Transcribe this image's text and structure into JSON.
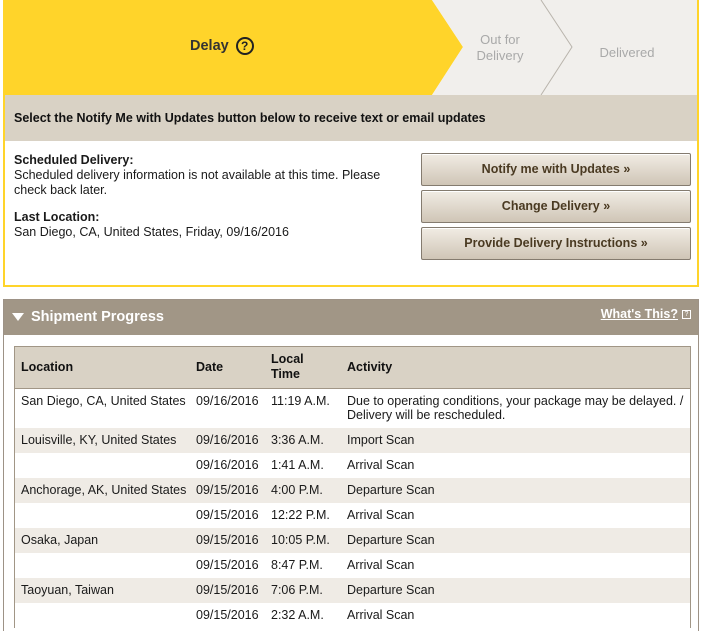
{
  "steps": {
    "current": "Delay",
    "help": "?",
    "out_for_delivery": "Out for\nDelivery",
    "delivered": "Delivered"
  },
  "colors": {
    "active": "#ffd42a",
    "inactive": "#f1efec",
    "band": "#d9d2c5",
    "header": "#a19686"
  },
  "notify_text": "Select the Notify Me with Updates button below to receive text or email updates",
  "scheduled": {
    "label": "Scheduled Delivery:",
    "text": "Scheduled delivery information is not available at this time. Please check back later."
  },
  "last_location": {
    "label": "Last Location:",
    "text": "San Diego, CA, United States, Friday, 09/16/2016"
  },
  "buttons": {
    "notify": "Notify me with Updates »",
    "change": "Change Delivery »",
    "instructions": "Provide Delivery Instructions »"
  },
  "shipment": {
    "title": "Shipment Progress",
    "whats_this": "What's This?",
    "headers": {
      "location": "Location",
      "date": "Date",
      "time": "Local\nTime",
      "activity": "Activity"
    },
    "rows": [
      {
        "location": "San Diego, CA, United States",
        "date": "09/16/2016",
        "time": "11:19 A.M.",
        "activity": "Due to operating conditions, your package may be delayed. / Delivery will be rescheduled."
      },
      {
        "location": "Louisville, KY, United States",
        "date": "09/16/2016",
        "time": "3:36 A.M.",
        "activity": "Import Scan"
      },
      {
        "location": "",
        "date": "09/16/2016",
        "time": "1:41 A.M.",
        "activity": "Arrival Scan"
      },
      {
        "location": "Anchorage, AK, United States",
        "date": "09/15/2016",
        "time": "4:00 P.M.",
        "activity": "Departure Scan"
      },
      {
        "location": "",
        "date": "09/15/2016",
        "time": "12:22 P.M.",
        "activity": "Arrival Scan"
      },
      {
        "location": "Osaka, Japan",
        "date": "09/15/2016",
        "time": "10:05 P.M.",
        "activity": "Departure Scan"
      },
      {
        "location": "",
        "date": "09/15/2016",
        "time": "8:47 P.M.",
        "activity": "Arrival Scan"
      },
      {
        "location": "Taoyuan, Taiwan",
        "date": "09/15/2016",
        "time": "7:06 P.M.",
        "activity": "Departure Scan"
      },
      {
        "location": "",
        "date": "09/15/2016",
        "time": "2:32 A.M.",
        "activity": "Arrival Scan"
      }
    ]
  }
}
